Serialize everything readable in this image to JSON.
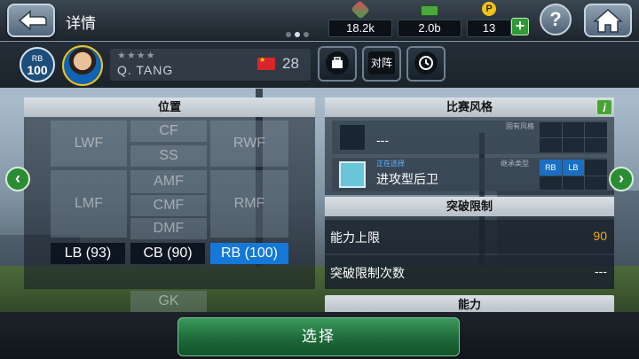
{
  "header": {
    "title": "详情",
    "page_count": 3,
    "active_page": 1,
    "resources": [
      {
        "icon": "gem-icon",
        "value": "18.2k"
      },
      {
        "icon": "cash-icon",
        "value": "2.0b"
      },
      {
        "icon": "coin-icon",
        "value": "13",
        "glyph": "P"
      }
    ],
    "plus_label": "+",
    "help_label": "?"
  },
  "player": {
    "position": "RB",
    "rating": "100",
    "stars": "★★★★",
    "name": "Q. TANG",
    "age": "28",
    "vs_label": "对阵"
  },
  "positions": {
    "title": "位置",
    "cells": [
      "LWF",
      "CF",
      "RWF",
      "SS",
      "AMF",
      "LMF",
      "CMF",
      "RMF",
      "DMF",
      "GK"
    ],
    "selected": [
      {
        "label": "LB (93)",
        "active": false
      },
      {
        "label": "CB (90)",
        "active": false
      },
      {
        "label": "RB (100)",
        "active": true
      }
    ]
  },
  "play_style": {
    "title": "比赛风格",
    "inherent_label": "固有风格",
    "inherent_value": "---",
    "selecting_label": "正在选择",
    "inherit_label": "继承类型",
    "current_style": "进攻型后卫",
    "inherit_tags": [
      "RB",
      "LB"
    ]
  },
  "breakthrough": {
    "title": "突破限制",
    "rows": [
      {
        "label": "能力上限",
        "value": "90",
        "color": "#f5a623"
      },
      {
        "label": "突破限制次数",
        "value": "---",
        "color": "#ffffff"
      }
    ]
  },
  "ability": {
    "title": "能力"
  },
  "actions": {
    "select_label": "选择"
  },
  "colors": {
    "accent_blue": "#1378d8",
    "accent_green": "#2c8c35",
    "highlight_orange": "#f5a623"
  }
}
